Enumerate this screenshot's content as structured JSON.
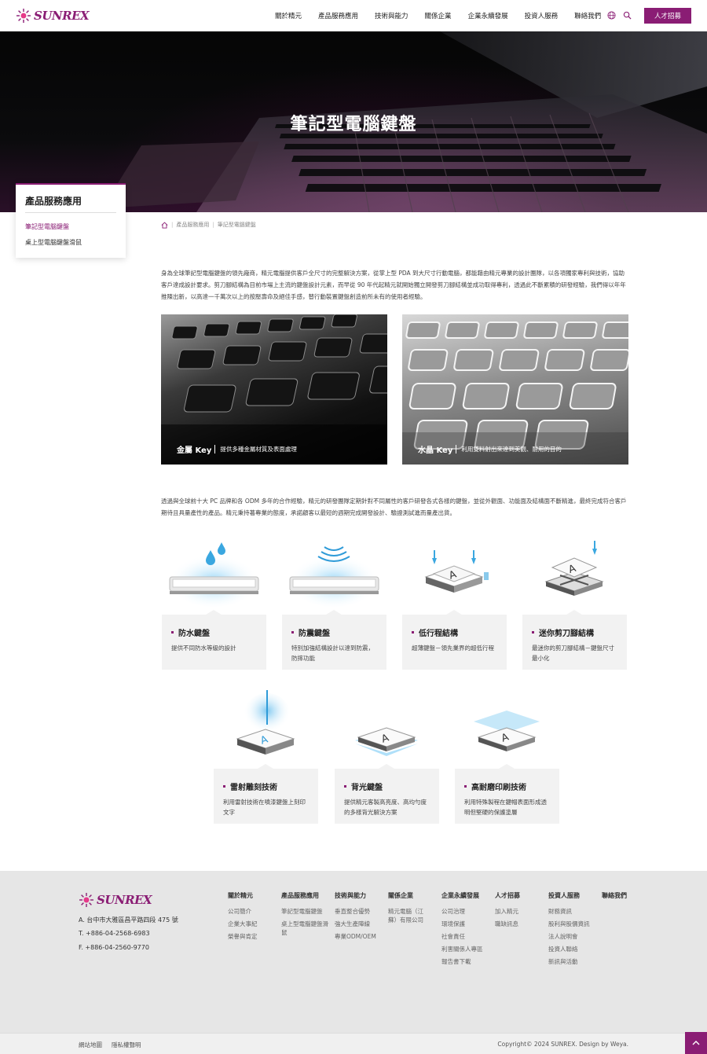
{
  "header": {
    "logo_text": "SUNREX",
    "nav": [
      "關於精元",
      "產品服務應用",
      "技術與能力",
      "關係企業",
      "企業永續發展",
      "投資人服務",
      "聯絡我們"
    ],
    "recruit_label": "人才招募"
  },
  "hero": {
    "title": "筆記型電腦鍵盤"
  },
  "sidebar": {
    "title": "產品服務應用",
    "items": [
      {
        "label": "筆記型電腦鍵盤",
        "active": true
      },
      {
        "label": "桌上型電腦鍵盤滑鼠",
        "active": false
      }
    ]
  },
  "breadcrumb": {
    "items": [
      "產品服務應用",
      "筆記型電腦鍵盤"
    ]
  },
  "intro": "身為全球筆記型電腦鍵盤的領先廠商，精元電腦提供客戶全尺寸的完整解決方案，從掌上型 PDA 到大尺寸行動電腦，都能藉由精元專業的設計團隊，以各項獨家專利與技術，協助客戶達成設計要求。剪刀腳結構為目前市場上主流的鍵盤設計元素，而早從 90 年代起精元就開始獨立開發剪刀腳結構並成功取得專利，透過此不斷累積的研發經驗，我們得以年年推陳出新，以高達一千萬次以上的按壓壽命及絕佳手感，替行動裝置鍵盤創造前所未有的使用者經驗。",
  "key_cards": [
    {
      "name": "金屬 Key",
      "desc": "提供多種金屬材質及表面處理"
    },
    {
      "name": "水晶 Key",
      "desc": "利用雙料射出來達到美觀、耐用的目的"
    }
  ],
  "second_para": "透過與全球前十大 PC 品牌和各 ODM 多年的合作經驗，精元的研發團隊定期針對不同屬性的客戶研發各式各樣的鍵盤，並從外觀面、功能面及結構面不斷精進，最終完成符合客戶期待且具量產性的產品。精元秉持著專業的態度，承諾顧客以最短的週期完成開發設計、驗證測試進而量產出貨。",
  "features": [
    {
      "title": "防水鍵盤",
      "desc": "提供不同防水等級的設計"
    },
    {
      "title": "防震鍵盤",
      "desc": "特別加強結構設計以達到防震，防摔功能"
    },
    {
      "title": "低行程結構",
      "desc": "超薄鍵盤－領先業界的超低行程"
    },
    {
      "title": "迷你剪刀腳結構",
      "desc": "最迷你的剪刀腳結構－鍵盤尺寸最小化"
    },
    {
      "title": "雷射雕刻技術",
      "desc": "利用雷射技術在噴漆鍵盤上刻印文字"
    },
    {
      "title": "背光鍵盤",
      "desc": "提供精元客製高亮度、高均勻度的多樣背光解決方案"
    },
    {
      "title": "高耐磨印刷技術",
      "desc": "利用特殊製程在鍵帽表面形成透明但堅硬的保護塗層"
    }
  ],
  "footer": {
    "address": "A. 台中市大雅區昌平路四段 475 號",
    "tel": "T. +886-04-2568-6983",
    "fax": "F. +886-04-2560-9770",
    "columns": [
      {
        "title": "關於精元",
        "items": [
          "公司簡介",
          "企業大事紀",
          "榮譽與肯定"
        ]
      },
      {
        "title": "產品服務應用",
        "items": [
          "筆記型電腦鍵盤",
          "桌上型電腦鍵盤滑鼠"
        ]
      },
      {
        "title": "技術與能力",
        "items": [
          "垂直整合優勢",
          "強大生產陣線",
          "專業ODM/OEM"
        ]
      },
      {
        "title": "關係企業",
        "items": [
          "精元電腦（江蘇）有限公司"
        ]
      },
      {
        "title": "企業永續發展",
        "items": [
          "公司治理",
          "環境保護",
          "社會責任",
          "利害關係人專區",
          "報告書下載"
        ]
      },
      {
        "title": "人才招募",
        "items": [
          "加入精元",
          "職缺訊息"
        ]
      },
      {
        "title": "投資人服務",
        "items": [
          "財務資訊",
          "股利與股價資訊",
          "法人說明會",
          "投資人聯絡",
          "新訊與活動"
        ]
      },
      {
        "title": "聯絡我們",
        "items": []
      }
    ],
    "bottom_links": [
      "網站地圖",
      "隱私權聲明"
    ],
    "copyright": "Copyright© 2024 SUNREX. Design by Weya."
  },
  "colors": {
    "brand": "#8a1d74"
  }
}
